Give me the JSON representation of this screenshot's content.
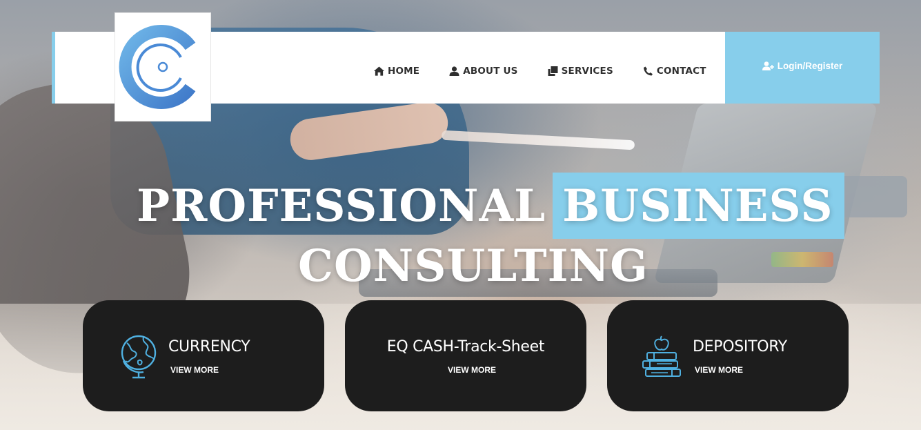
{
  "brand": {
    "logo_icon": "c-logo-icon",
    "accent_color": "#87ceeb"
  },
  "nav": {
    "items": [
      {
        "label": "HOME",
        "icon": "home-icon"
      },
      {
        "label": "ABOUT US",
        "icon": "user-icon"
      },
      {
        "label": "SERVICES",
        "icon": "clone-icon"
      },
      {
        "label": "CONTACT",
        "icon": "phone-icon"
      }
    ],
    "login_label": "Login/Register",
    "login_icon": "user-plus-icon"
  },
  "hero": {
    "title_part1": "PROFESSIONAL",
    "title_highlight": "BUSINESS",
    "title_line2": "CONSULTING"
  },
  "cards": [
    {
      "title": "CURRENCY",
      "link": "VIEW MORE",
      "icon": "globe-icon"
    },
    {
      "title": "EQ CASH-Track-Sheet",
      "link": "VIEW MORE",
      "icon": ""
    },
    {
      "title": "DEPOSITORY",
      "link": "VIEW MORE",
      "icon": "books-apple-icon"
    }
  ],
  "colors": {
    "card_bg": "#1d1d1d",
    "header_bg": "#ffffff",
    "nav_text": "#2f2f2f"
  }
}
